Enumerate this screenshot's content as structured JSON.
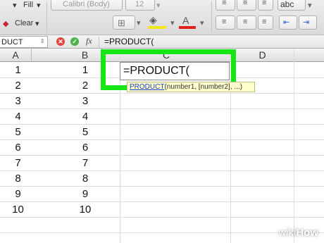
{
  "toolbar": {
    "fill_label": "Fill",
    "clear_label": "Clear",
    "font_name": "Calibri (Body)",
    "font_size": "12",
    "abc_label": "abc"
  },
  "formula_bar": {
    "name_box": "DUCT",
    "fx_label": "fx",
    "content": "=PRODUCT("
  },
  "columns": [
    "A",
    "B",
    "C",
    "D"
  ],
  "rows": [
    {
      "a": "1",
      "b": "1"
    },
    {
      "a": "2",
      "b": "2"
    },
    {
      "a": "3",
      "b": "3"
    },
    {
      "a": "4",
      "b": "4"
    },
    {
      "a": "5",
      "b": "5"
    },
    {
      "a": "6",
      "b": "6"
    },
    {
      "a": "7",
      "b": "7"
    },
    {
      "a": "8",
      "b": "8"
    },
    {
      "a": "9",
      "b": "9"
    },
    {
      "a": "10",
      "b": "10"
    }
  ],
  "active_cell": {
    "editor_text": "=PRODUCT(",
    "tooltip_fn": "PRODUCT",
    "tooltip_args": "(number1, [number2], ...)"
  },
  "watermark": {
    "prefix": "wiki",
    "suffix": "How"
  },
  "colors": {
    "highlight": "#17e616",
    "link": "#1a3fc4"
  }
}
